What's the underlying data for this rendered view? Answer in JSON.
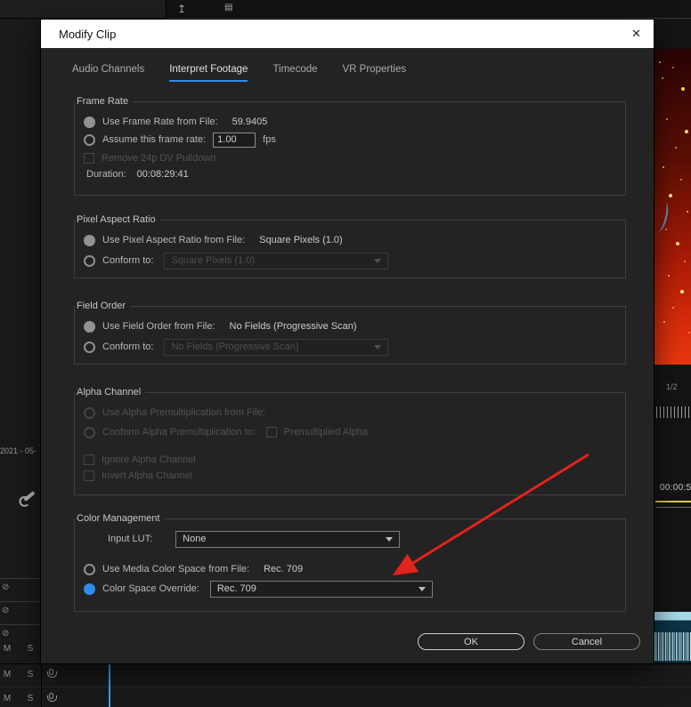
{
  "dialog": {
    "title": "Modify Clip",
    "close_icon": "✕",
    "tabs": [
      {
        "label": "Audio Channels"
      },
      {
        "label": "Interpret Footage"
      },
      {
        "label": "Timecode"
      },
      {
        "label": "VR Properties"
      }
    ],
    "active_tab": "Interpret Footage",
    "frame_rate": {
      "legend": "Frame Rate",
      "use_from_file_label": "Use Frame Rate from File:",
      "use_from_file_value": "59.9405",
      "assume_label": "Assume this frame rate:",
      "assume_value": "1.00",
      "fps_unit": "fps",
      "remove_pulldown_label": "Remove 24p DV Pulldown",
      "duration_label": "Duration:",
      "duration_value": "00:08:29:41"
    },
    "pixel_aspect_ratio": {
      "legend": "Pixel Aspect Ratio",
      "use_from_file_label": "Use Pixel Aspect Ratio from File:",
      "use_from_file_value": "Square Pixels (1.0)",
      "conform_label": "Conform to:",
      "conform_value": "Square Pixels (1.0)"
    },
    "field_order": {
      "legend": "Field Order",
      "use_from_file_label": "Use Field Order from File:",
      "use_from_file_value": "No Fields (Progressive Scan)",
      "conform_label": "Conform to:",
      "conform_value": "No Fields (Progressive Scan)"
    },
    "alpha_channel": {
      "legend": "Alpha Channel",
      "use_premult_label": "Use Alpha Premultiplication from File:",
      "conform_premult_label": "Conform Alpha Premultiplication to:",
      "premultiplied_label": "Premultiplied Alpha",
      "ignore_label": "Ignore Alpha Channel",
      "invert_label": "Invert Alpha Channel"
    },
    "color_management": {
      "legend": "Color Management",
      "input_lut_label": "Input LUT:",
      "input_lut_value": "None",
      "media_space_label": "Use Media Color Space from File:",
      "media_space_value": "Rec. 709",
      "override_label": "Color Space Override:",
      "override_value": "Rec. 709"
    },
    "ok_label": "OK",
    "cancel_label": "Cancel",
    "state": {
      "frame_rate_selected": "use_from_file",
      "pixel_aspect_selected": "use_from_file",
      "field_order_selected": "use_from_file",
      "color_selected": "color_space_override"
    }
  },
  "annotation": {
    "arrow_color": "#e3231d"
  },
  "colors": {
    "accent_blue": "#2d8ceb",
    "titlebar_bg": "#ffffff",
    "dialog_bg": "#232323"
  },
  "background": {
    "left_date": "2021 - 05-",
    "meter_channels": "1/2",
    "timecode": "00:00:5",
    "mute_label": "M",
    "solo_label": "S",
    "export_icon": "↥",
    "panel_icon": "▤",
    "fx_icon": "⊘"
  }
}
